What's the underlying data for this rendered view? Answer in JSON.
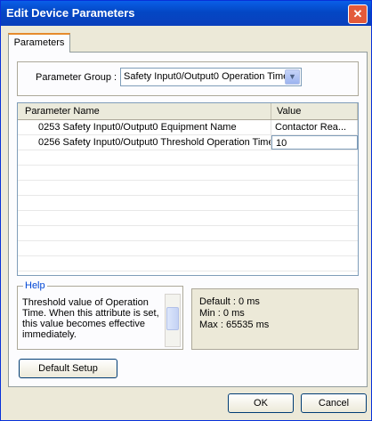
{
  "window": {
    "title": "Edit Device Parameters",
    "close_glyph": "✕"
  },
  "tabs": [
    {
      "label": "Parameters"
    }
  ],
  "parameter_group": {
    "label": "Parameter Group :",
    "value": "Safety Input0/Output0 Operation Time",
    "arrow_glyph": "▼"
  },
  "grid": {
    "columns": [
      "Parameter Name",
      "Value"
    ],
    "rows": [
      {
        "name": "0253 Safety Input0/Output0 Equipment Name",
        "value": "Contactor Rea..."
      },
      {
        "name": "0256 Safety Input0/Output0 Threshold Operation Time",
        "value": "10"
      }
    ]
  },
  "help": {
    "label": "Help",
    "text": "Threshold value of Operation Time. When this attribute is set, this value becomes effective immediately."
  },
  "info": {
    "default": "Default : 0 ms",
    "min": "Min : 0 ms",
    "max": "Max : 65535 ms"
  },
  "buttons": {
    "default_setup": "Default Setup",
    "ok": "OK",
    "cancel": "Cancel"
  }
}
